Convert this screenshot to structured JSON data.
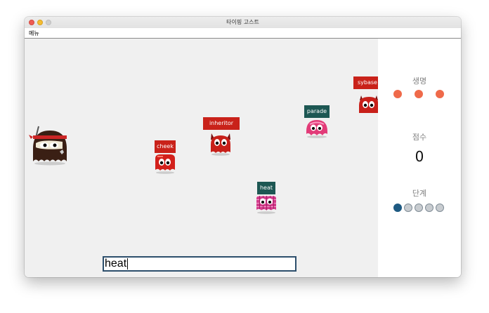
{
  "window": {
    "title": "타이핑 고스트"
  },
  "menu": {
    "items": [
      {
        "label": "메뉴"
      }
    ]
  },
  "ghosts": [
    {
      "word": "sybase",
      "type": "red-devil"
    },
    {
      "word": "parade",
      "type": "pink-octopus"
    },
    {
      "word": "inheritor",
      "type": "red-devil"
    },
    {
      "word": "cheek",
      "type": "red-cube"
    },
    {
      "word": "heat",
      "type": "plaid-cube"
    }
  ],
  "player": {
    "type": "ninja-ghost"
  },
  "input": {
    "value": "heat"
  },
  "status": {
    "lives_label": "생명",
    "lives": 3,
    "score_label": "점수",
    "score": "0",
    "stage_label": "단계",
    "stage_total": 5,
    "stage_current": 1
  },
  "colors": {
    "life": "#ef6a4a",
    "label_red": "#c9221a",
    "label_teal": "#1d5753",
    "stage_active": "#1e5a82",
    "input_border": "#2d4f6c"
  }
}
